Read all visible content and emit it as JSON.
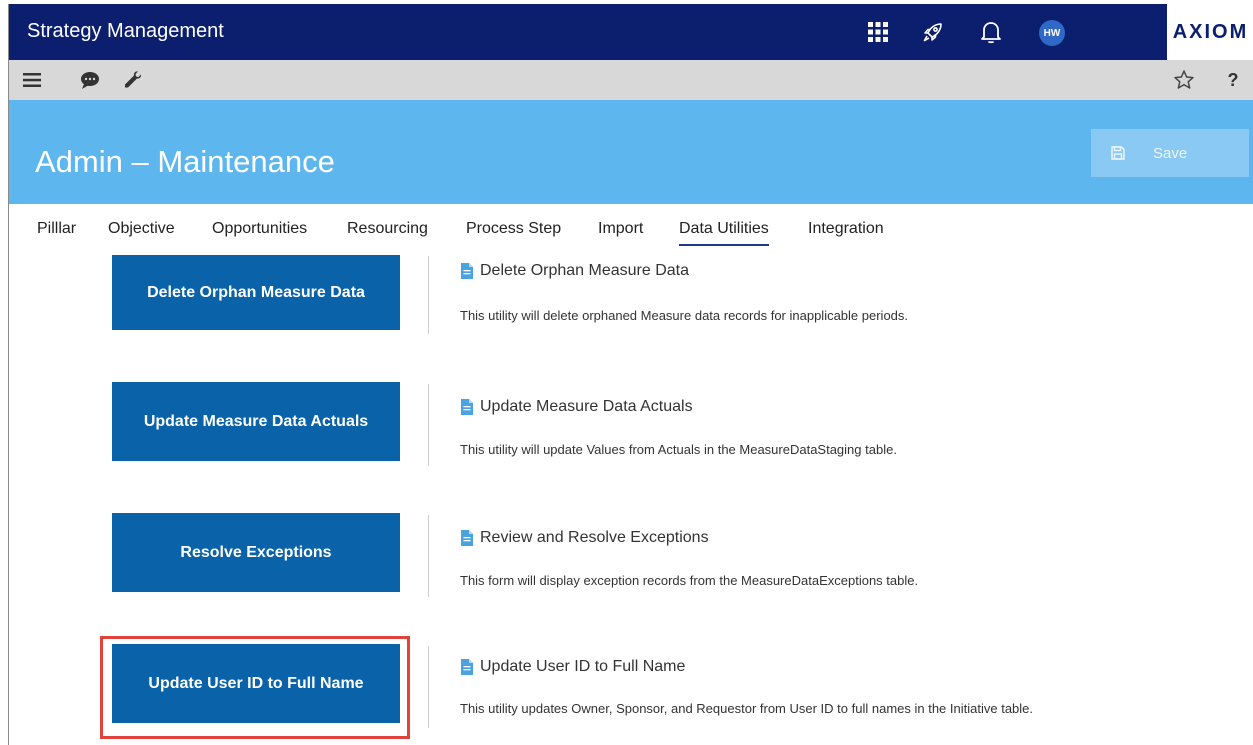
{
  "app": {
    "title": "Strategy Management",
    "brand": "AXIOM",
    "avatar_initials": "HW"
  },
  "topbar": {
    "icons": [
      "apps-grid-icon",
      "rocket-icon",
      "bell-icon"
    ]
  },
  "toolbar": {
    "left_icons": [
      "menu-icon",
      "chat-icon",
      "wrench-icon"
    ],
    "right_icons": [
      "star-icon",
      "help-icon"
    ],
    "help_label": "?"
  },
  "page": {
    "title": "Admin – Maintenance",
    "save_label": "Save"
  },
  "tabs": [
    {
      "label": "Pilllar",
      "active": false
    },
    {
      "label": "Objective",
      "active": false
    },
    {
      "label": "Opportunities",
      "active": false
    },
    {
      "label": "Resourcing",
      "active": false
    },
    {
      "label": "Process Step",
      "active": false
    },
    {
      "label": "Import",
      "active": false
    },
    {
      "label": "Data Utilities",
      "active": true
    },
    {
      "label": "Integration",
      "active": false
    }
  ],
  "utilities": [
    {
      "button_label": "Delete Orphan Measure Data",
      "title": "Delete Orphan Measure Data",
      "description": "This utility will delete orphaned Measure data records for inapplicable periods."
    },
    {
      "button_label": "Update Measure Data Actuals",
      "title": "Update Measure Data Actuals",
      "description": "This utility will update Values from Actuals in the MeasureDataStaging table."
    },
    {
      "button_label": "Resolve Exceptions",
      "title": "Review and Resolve Exceptions",
      "description": "This form will display exception records from the MeasureDataExceptions table."
    },
    {
      "button_label": "Update User ID to Full Name",
      "title": "Update User ID to Full Name",
      "description": "This utility updates Owner, Sponsor, and Requestor from User ID to full names in the Initiative table."
    }
  ],
  "colors": {
    "topbar": "#0b1f6e",
    "banner": "#5eb6ef",
    "button": "#0a62a8",
    "highlight": "#e0433c"
  }
}
